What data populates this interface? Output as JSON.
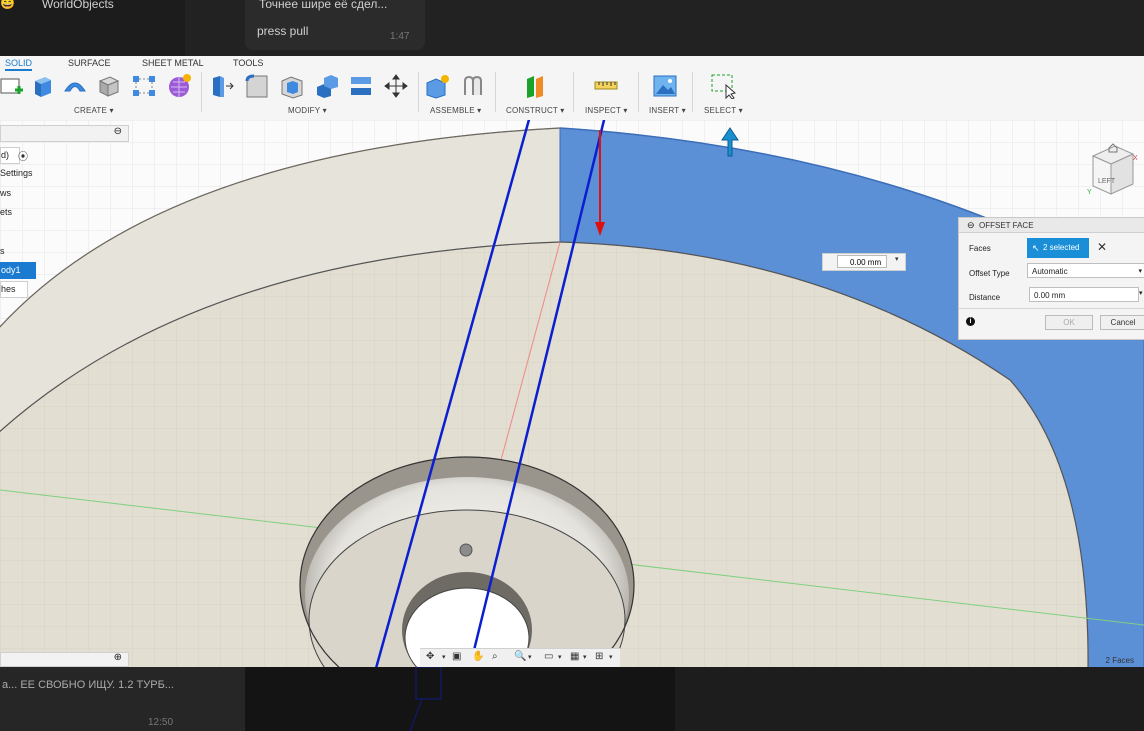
{
  "chat": {
    "top_name": "WorldObjects",
    "top_msg": "Точнее шире её сдел...",
    "top_msg2": "press pull",
    "top_time": "1:47",
    "bottom_text": "а... ЕЕ СВОБНО ИЩУ. 1.2 ТУРБ...",
    "bottom_time": "12:50"
  },
  "ribbon": {
    "tabs": [
      "SOLID",
      "SURFACE",
      "SHEET METAL",
      "TOOLS"
    ],
    "groups": [
      "CREATE ▾",
      "MODIFY ▾",
      "ASSEMBLE ▾",
      "CONSTRUCT ▾",
      "INSPECT ▾",
      "INSERT ▾",
      "SELECT ▾"
    ]
  },
  "browser": {
    "items": [
      "d)",
      "Settings",
      "ws",
      "ets",
      "s",
      "ody1",
      "hes"
    ]
  },
  "viewcube": {
    "face_label": "LEFT",
    "axis_x": "X",
    "axis_y": "Y"
  },
  "inline_input": {
    "value": "0.00 mm"
  },
  "offset_panel": {
    "title": "OFFSET FACE",
    "faces_label": "Faces",
    "faces_value": "2 selected",
    "offset_type_label": "Offset Type",
    "offset_type_value": "Automatic",
    "distance_label": "Distance",
    "distance_value": "0.00 mm",
    "ok_label": "OK",
    "cancel_label": "Cancel"
  },
  "status": {
    "faces_count": "2 Faces"
  },
  "colors": {
    "accent": "#1a7bd0",
    "selected_face": "#5b8fd6",
    "annotation_blue": "#0b1fd1",
    "annotation_red": "#e01010"
  }
}
